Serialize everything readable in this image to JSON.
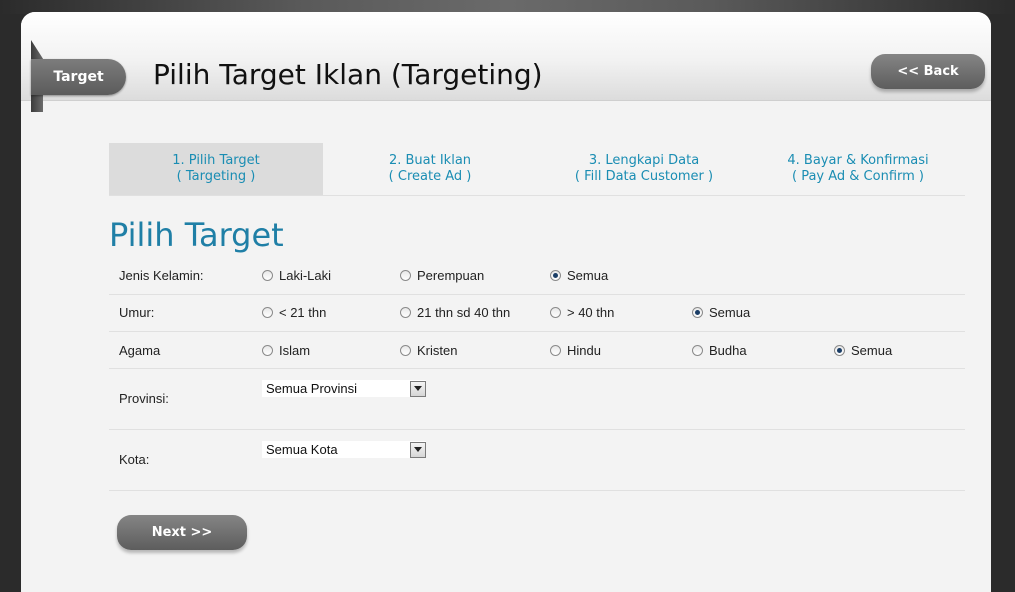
{
  "header": {
    "target_tab": "Target",
    "title": "Pilih Target Iklan (Targeting)",
    "back_label": "<< Back"
  },
  "steps": [
    {
      "line1": "1. Pilih Target",
      "line2": "( Targeting )"
    },
    {
      "line1": "2. Buat Iklan",
      "line2": "( Create Ad )"
    },
    {
      "line1": "3. Lengkapi Data",
      "line2": "( Fill Data Customer )"
    },
    {
      "line1": "4. Bayar & Konfirmasi",
      "line2": "( Pay Ad & Confirm )"
    }
  ],
  "section_title": "Pilih Target",
  "gender": {
    "label": "Jenis Kelamin:",
    "options": [
      "Laki-Laki",
      "Perempuan",
      "Semua"
    ],
    "selected": "Semua"
  },
  "age": {
    "label": "Umur:",
    "options": [
      "< 21 thn",
      "21 thn sd 40 thn",
      "> 40 thn",
      "Semua"
    ],
    "selected": "Semua"
  },
  "religion": {
    "label": "Agama",
    "options": [
      "Islam",
      "Kristen",
      "Hindu",
      "Budha",
      "Semua"
    ],
    "selected": "Semua"
  },
  "province": {
    "label": "Provinsi:",
    "value": "Semua Provinsi"
  },
  "city": {
    "label": "Kota:",
    "value": "Semua Kota"
  },
  "next_label": "Next >>"
}
